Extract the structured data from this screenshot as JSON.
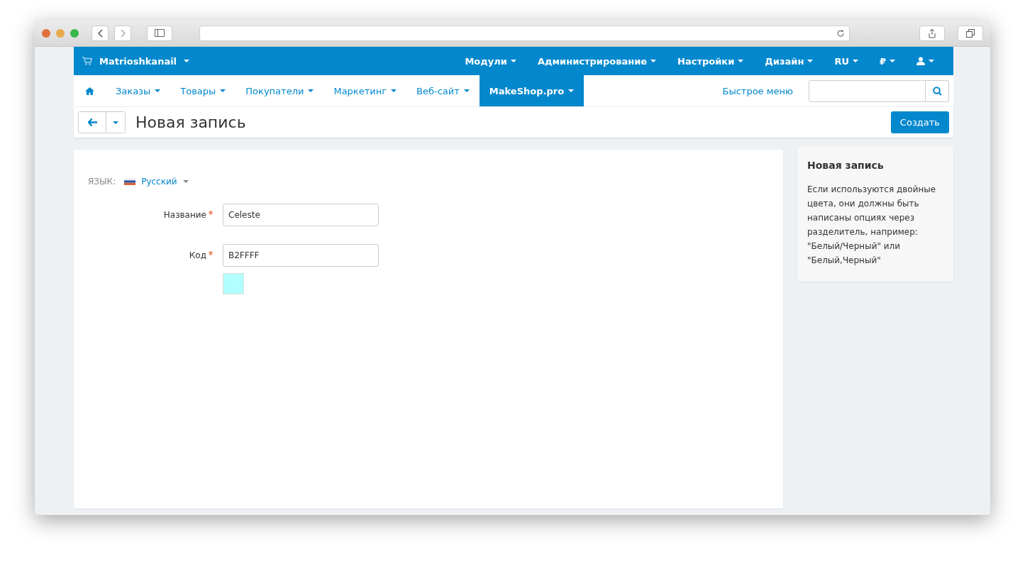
{
  "brand": {
    "label": "Matrioshkanail"
  },
  "top_menu": [
    {
      "kind": "text",
      "label": "Модули"
    },
    {
      "kind": "text",
      "label": "Администрирование"
    },
    {
      "kind": "text",
      "label": "Настройки"
    },
    {
      "kind": "text",
      "label": "Дизайн"
    },
    {
      "kind": "text",
      "label": "RU"
    },
    {
      "kind": "text",
      "label": "₽"
    },
    {
      "kind": "user"
    }
  ],
  "nav": [
    {
      "label": "Заказы",
      "selected": false
    },
    {
      "label": "Товары",
      "selected": false
    },
    {
      "label": "Покупатели",
      "selected": false
    },
    {
      "label": "Маркетинг",
      "selected": false
    },
    {
      "label": "Веб-сайт",
      "selected": false
    },
    {
      "label": "MakeShop.pro",
      "selected": true
    }
  ],
  "quick_menu": "Быстрое меню",
  "page_title": "Новая запись",
  "create_button": "Создать",
  "language": {
    "label": "ЯЗЫК:",
    "value": "Русский"
  },
  "fields": [
    {
      "label": "Название",
      "required": true,
      "value": "Celeste",
      "kind": "text"
    },
    {
      "label": "Код",
      "required": true,
      "value": "B2FFFF",
      "kind": "color"
    }
  ],
  "sidebar": {
    "title": "Новая запись",
    "text": "Если используются двойные цвета, они должны быть написаны опциях через разделитель, например: \"Белый/Черный\" или \"Белый,Черный\""
  }
}
